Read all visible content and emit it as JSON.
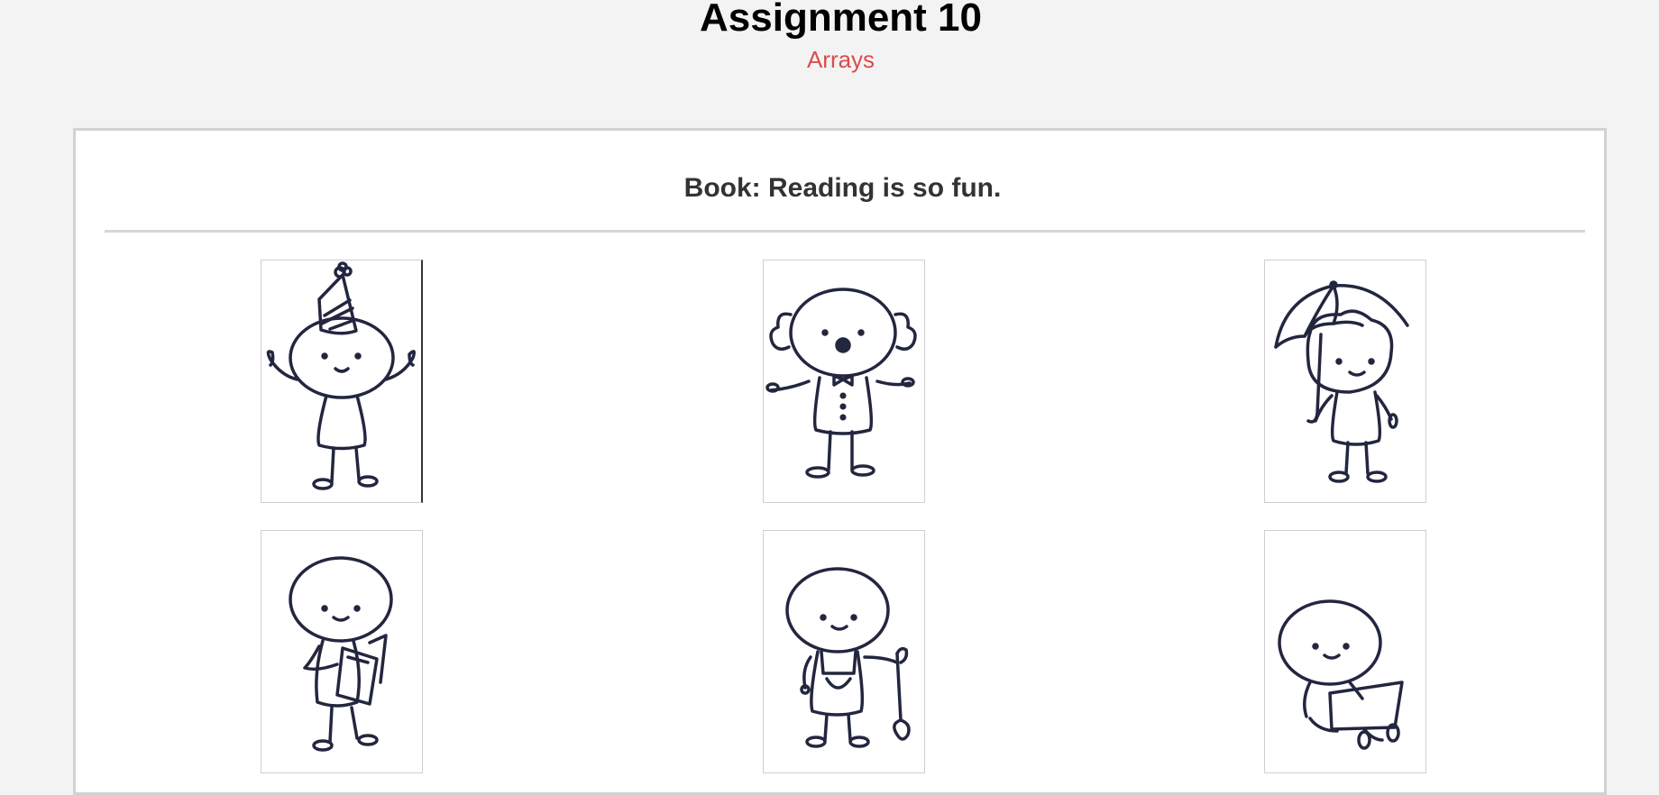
{
  "page": {
    "title": "Assignment 10",
    "subtitle": "Arrays"
  },
  "book": {
    "title": "Book: Reading is so fun."
  },
  "gallery": {
    "items": [
      {
        "name": "party-hat-figure-image",
        "icon": "stick-figure-party-hat"
      },
      {
        "name": "clown-figure-image",
        "icon": "stick-figure-clown"
      },
      {
        "name": "umbrella-figure-image",
        "icon": "stick-figure-umbrella"
      },
      {
        "name": "reading-figure-image",
        "icon": "stick-figure-reading-book"
      },
      {
        "name": "gardener-figure-image",
        "icon": "stick-figure-shovel"
      },
      {
        "name": "laptop-figure-image",
        "icon": "stick-figure-laptop"
      }
    ],
    "stroke_color": "#23263f"
  },
  "colors": {
    "background": "#f3f3f3",
    "subtitle": "#dd4b4b",
    "card": "#ffffff",
    "border": "#d2d2d2"
  }
}
